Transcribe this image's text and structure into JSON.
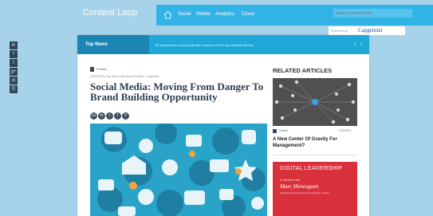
{
  "header": {
    "brand": "Content Loop",
    "nav": [
      "Social",
      "Mobile",
      "Analytics",
      "Cloud"
    ],
    "search_placeholder": "Search content here...",
    "powered_by": "Powered by",
    "partner_logo": "Capgemini"
  },
  "social_rail": [
    {
      "icon": "linkedin-icon",
      "glyph": "in"
    },
    {
      "icon": "facebook-icon",
      "glyph": "f"
    },
    {
      "icon": "twitter-icon",
      "glyph": "t"
    },
    {
      "icon": "googleplus-icon",
      "glyph": "g+"
    },
    {
      "icon": "rss-icon",
      "glyph": "◎"
    },
    {
      "icon": "link-icon",
      "glyph": "⎘"
    }
  ],
  "news_bar": {
    "title": "Top News",
    "ticker": "GE announces a smart bulb that connects to iOS and Android devices",
    "prev": "‹",
    "next": "›"
  },
  "article": {
    "source": "Forbes",
    "meta": "02/26/2013 | Top News | By Jeanne Meister, Contributor",
    "title": "Social Media: Moving From Danger To Brand Building Opportunity",
    "share": [
      "G+",
      "in",
      "t",
      "f",
      "V"
    ]
  },
  "related": {
    "heading": "RELATED ARTICLES",
    "source": "Forbes",
    "date": "7/18/2013",
    "headline": "A New Center Of Gravity For Management?"
  },
  "ad": {
    "title": "DIGITAL LEADERSHIP",
    "subtitle": "In Interview with",
    "name": "Marc Menesguen",
    "line": "Managing Director, Beauty & Lifestyle, L'Oréal"
  },
  "colors": {
    "page_bg": "#a7d3ea",
    "nav_bg": "#32b3e6",
    "news_bar": "#20a7d9",
    "title": "#2d3e50",
    "ad_red": "#d9313c"
  }
}
